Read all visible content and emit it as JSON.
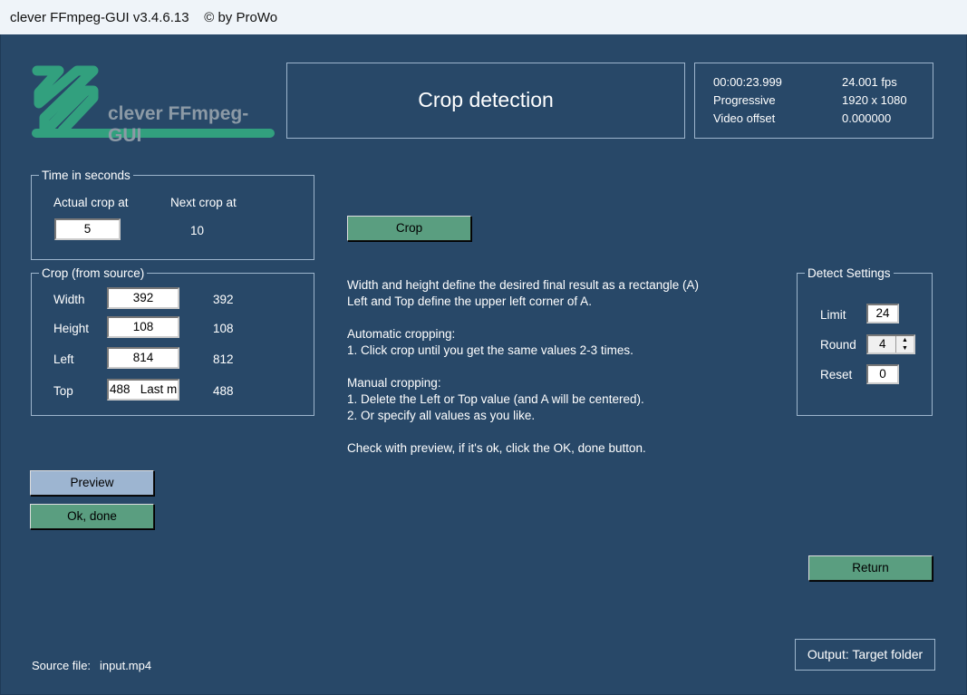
{
  "window": {
    "title": "clever FFmpeg-GUI v3.4.6.13    © by ProWo"
  },
  "logo": {
    "text": "clever FFmpeg-GUI"
  },
  "header": {
    "title": "Crop detection"
  },
  "info": {
    "duration": "00:00:23.999",
    "fps": "24.001 fps",
    "scan": "Progressive",
    "resolution": "1920 x 1080",
    "offset_label": "Video offset",
    "offset_value": "0.000000"
  },
  "time": {
    "legend": "Time in seconds",
    "actual_label": "Actual crop at",
    "next_label": "Next crop at",
    "actual_value": "5",
    "next_value": "10"
  },
  "crop": {
    "legend": "Crop (from source)",
    "rows": [
      {
        "label": "Width",
        "value": "392",
        "detected": "392"
      },
      {
        "label": "Height",
        "value": "108",
        "detected": "108"
      },
      {
        "label": "Left",
        "value": "814",
        "detected": "812"
      },
      {
        "label": "Top",
        "value": "488   Last m",
        "detected": "488"
      }
    ]
  },
  "buttons": {
    "crop": "Crop",
    "preview": "Preview",
    "ok": "Ok, done",
    "return": "Return",
    "output": "Output: Target folder"
  },
  "instructions": [
    "Width and height define the desired final result as a rectangle (A)",
    "Left and Top define the upper left corner of A.",
    "",
    "Automatic cropping:",
    "1. Click crop until you get the same values 2-3 times.",
    "",
    "Manual cropping:",
    "1. Delete the Left or Top value (and A will be centered).",
    "2. Or specify all values as you like.",
    "",
    "Check with preview, if it's ok, click the OK, done button."
  ],
  "detect": {
    "legend": "Detect Settings",
    "limit_label": "Limit",
    "limit": "24",
    "round_label": "Round",
    "round": "4",
    "reset_label": "Reset",
    "reset": "0"
  },
  "source": {
    "label": "Source file:",
    "file": "input.mp4"
  },
  "colors": {
    "background": "#284868",
    "accent_green": "#5a9e80",
    "button_blue": "#9db5d1"
  }
}
